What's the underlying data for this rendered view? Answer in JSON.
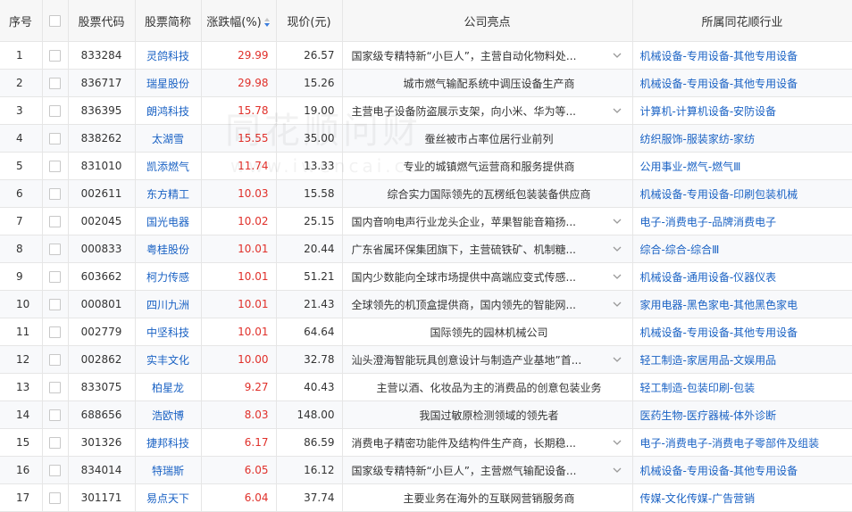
{
  "headers": {
    "idx": "序号",
    "code": "股票代码",
    "name": "股票简称",
    "change": "涨跌幅(%)",
    "price": "现价(元)",
    "highlight": "公司亮点",
    "industry": "所属同花顺行业"
  },
  "watermark": {
    "cn": "同花顺问财",
    "en": "www.iwencai.com"
  },
  "colors": {
    "up": "#e0302a",
    "link": "#1a62c4"
  },
  "rows": [
    {
      "idx": "1",
      "code": "833284",
      "name": "灵鸽科技",
      "change": "29.99",
      "price": "26.57",
      "highlight": "国家级专精特新“小巨人”，主营自动化物料处...",
      "expand": true,
      "industry": "机械设备-专用设备-其他专用设备"
    },
    {
      "idx": "2",
      "code": "836717",
      "name": "瑞星股份",
      "change": "29.98",
      "price": "15.26",
      "highlight": "城市燃气输配系统中调压设备生产商",
      "expand": false,
      "industry": "机械设备-专用设备-其他专用设备"
    },
    {
      "idx": "3",
      "code": "836395",
      "name": "朗鸿科技",
      "change": "15.78",
      "price": "19.00",
      "highlight": "主营电子设备防盗展示支架，向小米、华为等...",
      "expand": true,
      "industry": "计算机-计算机设备-安防设备"
    },
    {
      "idx": "4",
      "code": "838262",
      "name": "太湖雪",
      "change": "15.55",
      "price": "35.00",
      "highlight": "蚕丝被市占率位居行业前列",
      "expand": false,
      "industry": "纺织服饰-服装家纺-家纺"
    },
    {
      "idx": "5",
      "code": "831010",
      "name": "凯添燃气",
      "change": "11.74",
      "price": "13.33",
      "highlight": "专业的城镇燃气运营商和服务提供商",
      "expand": false,
      "industry": "公用事业-燃气-燃气Ⅲ"
    },
    {
      "idx": "6",
      "code": "002611",
      "name": "东方精工",
      "change": "10.03",
      "price": "15.58",
      "highlight": "综合实力国际领先的瓦楞纸包装装备供应商",
      "expand": false,
      "industry": "机械设备-专用设备-印刷包装机械"
    },
    {
      "idx": "7",
      "code": "002045",
      "name": "国光电器",
      "change": "10.02",
      "price": "25.15",
      "highlight": "国内音响电声行业龙头企业，苹果智能音箱扬...",
      "expand": true,
      "industry": "电子-消费电子-品牌消费电子"
    },
    {
      "idx": "8",
      "code": "000833",
      "name": "粤桂股份",
      "change": "10.01",
      "price": "20.44",
      "highlight": "广东省属环保集团旗下，主营硫铁矿、机制糖...",
      "expand": true,
      "industry": "综合-综合-综合Ⅲ"
    },
    {
      "idx": "9",
      "code": "603662",
      "name": "柯力传感",
      "change": "10.01",
      "price": "51.21",
      "highlight": "国内少数能向全球市场提供中高端应变式传感...",
      "expand": true,
      "industry": "机械设备-通用设备-仪器仪表"
    },
    {
      "idx": "10",
      "code": "000801",
      "name": "四川九洲",
      "change": "10.01",
      "price": "21.43",
      "highlight": "全球领先的机顶盒提供商，国内领先的智能网...",
      "expand": true,
      "industry": "家用电器-黑色家电-其他黑色家电"
    },
    {
      "idx": "11",
      "code": "002779",
      "name": "中坚科技",
      "change": "10.01",
      "price": "64.64",
      "highlight": "国际领先的园林机械公司",
      "expand": false,
      "industry": "机械设备-专用设备-其他专用设备"
    },
    {
      "idx": "12",
      "code": "002862",
      "name": "实丰文化",
      "change": "10.00",
      "price": "32.78",
      "highlight": "汕头澄海智能玩具创意设计与制造产业基地”首...",
      "expand": true,
      "industry": "轻工制造-家居用品-文娱用品"
    },
    {
      "idx": "13",
      "code": "833075",
      "name": "柏星龙",
      "change": "9.27",
      "price": "40.43",
      "highlight": "主营以酒、化妆品为主的消费品的创意包装业务",
      "expand": false,
      "industry": "轻工制造-包装印刷-包装"
    },
    {
      "idx": "14",
      "code": "688656",
      "name": "浩欧博",
      "change": "8.03",
      "price": "148.00",
      "highlight": "我国过敏原检测领域的领先者",
      "expand": false,
      "industry": "医药生物-医疗器械-体外诊断"
    },
    {
      "idx": "15",
      "code": "301326",
      "name": "捷邦科技",
      "change": "6.17",
      "price": "86.59",
      "highlight": "消费电子精密功能件及结构件生产商，长期稳...",
      "expand": true,
      "industry": "电子-消费电子-消费电子零部件及组装"
    },
    {
      "idx": "16",
      "code": "834014",
      "name": "特瑞斯",
      "change": "6.05",
      "price": "16.12",
      "highlight": "国家级专精特新“小巨人”，主营燃气输配设备...",
      "expand": true,
      "industry": "机械设备-专用设备-其他专用设备"
    },
    {
      "idx": "17",
      "code": "301171",
      "name": "易点天下",
      "change": "6.04",
      "price": "37.74",
      "highlight": "主要业务在海外的互联网营销服务商",
      "expand": false,
      "industry": "传媒-文化传媒-广告营销"
    }
  ]
}
